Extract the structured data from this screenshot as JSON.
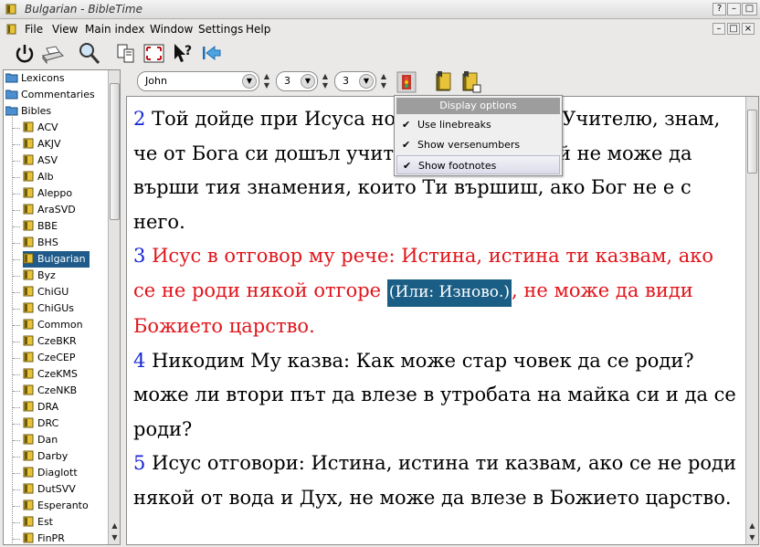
{
  "window": {
    "title": "Bulgarian - BibleTime",
    "btn_help": "?",
    "btn_minimize": "–",
    "btn_maximize": "□",
    "btn_close": "×"
  },
  "menubar": {
    "items": [
      "File",
      "View",
      "Main index",
      "Window",
      "Settings",
      "Help"
    ],
    "mdi_minimize": "–",
    "mdi_restore": "□",
    "mdi_close": "×"
  },
  "toolbar": {
    "icons": [
      "quit-icon",
      "print-icon",
      "search-icon",
      "tile-windows-icon",
      "fullscreen-icon",
      "whats-this-icon",
      "back-icon"
    ]
  },
  "sidebar": {
    "categories": [
      "Lexicons",
      "Commentaries",
      "Bibles"
    ],
    "modules": [
      "ACV",
      "AKJV",
      "ASV",
      "Alb",
      "Aleppo",
      "AraSVD",
      "BBE",
      "BHS",
      "Bulgarian",
      "Byz",
      "ChiGU",
      "ChiGUs",
      "Common",
      "CzeBKR",
      "CzeCEP",
      "CzeKMS",
      "CzeNKB",
      "DRA",
      "DRC",
      "Dan",
      "Darby",
      "Diaglott",
      "DutSVV",
      "Esperanto",
      "Est",
      "FinPR"
    ],
    "selected": "Bulgarian"
  },
  "reader_toolbar": {
    "book": "John",
    "chapter": "3",
    "verse": "3",
    "drop_glyph": "▼",
    "spin_up": "▲",
    "spin_down": "▼"
  },
  "reader": {
    "v2_num": "2",
    "v2_text": "Той дойде при Исуса нощем и Му рече: Учителю, знам, че от Бога си дошъл учител, защото никой не може да върши тия знамения, които Ти вършиш, ако Бог не е с него.",
    "v3_num": "3",
    "v3_text_a": "Исус в отговор му рече: Истина, истина ти казвам, ако се не роди някой отгоре",
    "v3_footnote": "(Или: Изново.)",
    "v3_text_b": ", не може да види Божието царство.",
    "v4_num": "4",
    "v4_text": "Никодим Му казва: Как може стар човек да се роди? може ли втори път да влезе в утробата на майка си и да се роди?",
    "v5_num": "5",
    "v5_text": "Исус отговори: Истина, истина ти казвам, ако се не роди някой от вода и Дух, не може да влезе в Божието царство."
  },
  "display_options": {
    "title": "Display options",
    "items": [
      {
        "label": "Use linebreaks",
        "checked": true
      },
      {
        "label": "Show versenumbers",
        "checked": true
      },
      {
        "label": "Show footnotes",
        "checked": true
      }
    ],
    "check_glyph": "✔"
  },
  "colors": {
    "selection": "#1f5a8a",
    "verse_number": "#1525d6",
    "words_of_christ": "#e0161c",
    "footnote_bg": "#1a5e85"
  }
}
